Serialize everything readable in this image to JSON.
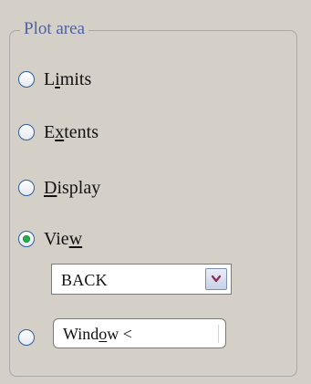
{
  "group": {
    "title": "Plot area"
  },
  "options": [
    {
      "before": "L",
      "mnemonic": "i",
      "after": "mits",
      "checked": false
    },
    {
      "before": "E",
      "mnemonic": "x",
      "after": "tents",
      "checked": false
    },
    {
      "before": "",
      "mnemonic": "D",
      "after": "isplay",
      "checked": false
    },
    {
      "before": "Vie",
      "mnemonic": "w",
      "after": "",
      "checked": true
    }
  ],
  "view_dropdown": {
    "selected": "BACK",
    "icon": "chevron-down-icon"
  },
  "window_option": {
    "checked": false,
    "label_before": "Wind",
    "label_mnemonic": "o",
    "label_after": "w <"
  },
  "colors": {
    "background": "#d4d0c8",
    "legend_text": "#4d61a8",
    "radio_selected": "#20b24b",
    "chevron": "#8b2d5b"
  }
}
